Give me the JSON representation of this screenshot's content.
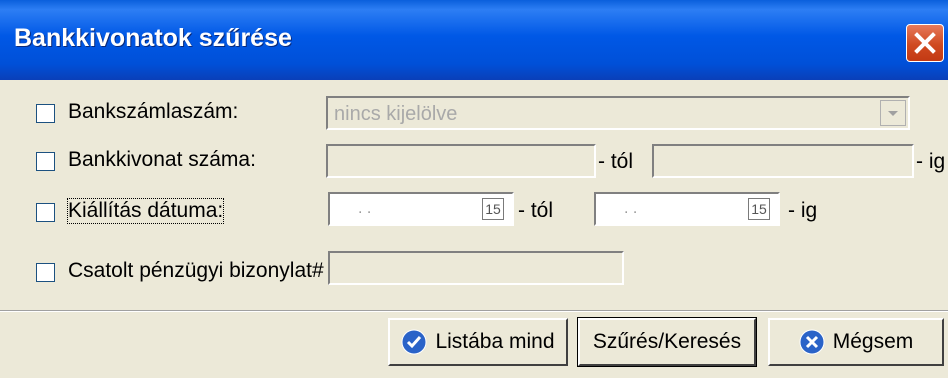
{
  "window": {
    "title": "Bankkivonatok szűrése"
  },
  "rows": {
    "account": {
      "label": "Bankszámlaszám:",
      "value": "nincs kijelölve",
      "checked": false
    },
    "statement": {
      "label": "Bankkivonat száma:",
      "from_suffix": "- tól",
      "to_suffix": "- ig",
      "checked": false
    },
    "date": {
      "label": "Kiállítás dátuma:",
      "from_value": ". .",
      "to_value": ". .",
      "from_suffix": "- tól",
      "to_suffix": "- ig",
      "calendar_glyph": "15",
      "checked": false
    },
    "voucher": {
      "label": "Csatolt pénzügyi bizonylat#",
      "checked": false
    }
  },
  "buttons": {
    "list_all": "Listába mind",
    "filter": "Szűrés/Keresés",
    "cancel": "Mégsem"
  },
  "colors": {
    "title_bar": "#0054e3",
    "close_red": "#d04a20",
    "dialog_bg": "#ece9d8",
    "icon_blue": "#2a63c8"
  }
}
